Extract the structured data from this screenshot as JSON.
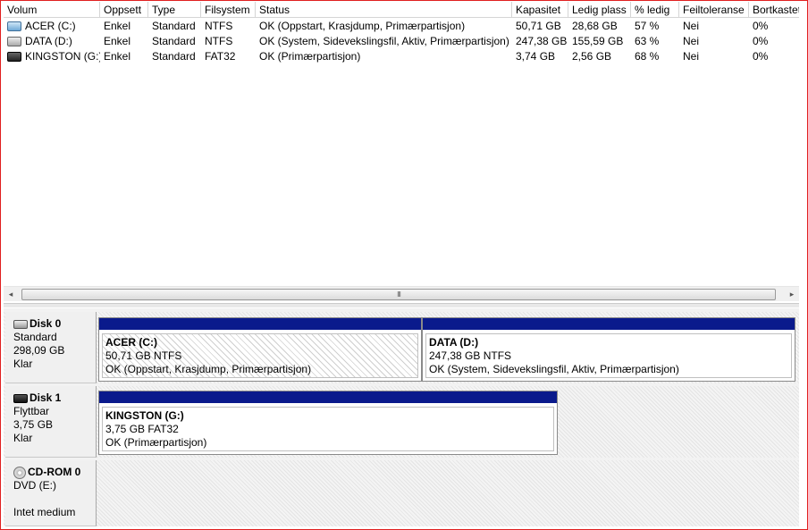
{
  "columns": [
    "Volum",
    "Oppsett",
    "Type",
    "Filsystem",
    "Status",
    "Kapasitet",
    "Ledig plass",
    "% ledig",
    "Feiltoleranse",
    "Bortkastet"
  ],
  "volumes": [
    {
      "icon": "drive-blue-icon",
      "name": "ACER (C:)",
      "layout": "Enkel",
      "type": "Standard",
      "fs": "NTFS",
      "status": "OK (Oppstart, Krasjdump, Primærpartisjon)",
      "capacity": "50,71 GB",
      "free": "28,68 GB",
      "pct": "57 %",
      "fault": "Nei",
      "overhead": "0%"
    },
    {
      "icon": "drive-gray-icon",
      "name": "DATA (D:)",
      "layout": "Enkel",
      "type": "Standard",
      "fs": "NTFS",
      "status": "OK (System, Sidevekslingsfil, Aktiv, Primærpartisjon)",
      "capacity": "247,38 GB",
      "free": "155,59 GB",
      "pct": "63 %",
      "fault": "Nei",
      "overhead": "0%"
    },
    {
      "icon": "usb-drive-icon",
      "name": "KINGSTON (G:)",
      "layout": "Enkel",
      "type": "Standard",
      "fs": "FAT32",
      "status": "OK (Primærpartisjon)",
      "capacity": "3,74 GB",
      "free": "2,56 GB",
      "pct": "68 %",
      "fault": "Nei",
      "overhead": "0%"
    }
  ],
  "scrollbar": {
    "left_arrow": "◂",
    "right_arrow": "▸",
    "grip": "III"
  },
  "disks": [
    {
      "name": "Disk 0",
      "kind": "Standard",
      "size": "298,09 GB",
      "state": "Klar",
      "partitions": [
        {
          "name": "ACER  (C:)",
          "size_fs": "50,71 GB NTFS",
          "status": "OK (Oppstart, Krasjdump, Primærpartisjon)"
        },
        {
          "name": "DATA  (D:)",
          "size_fs": "247,38 GB NTFS",
          "status": "OK (System, Sidevekslingsfil, Aktiv, Primærpartisjon)"
        }
      ]
    },
    {
      "name": "Disk 1",
      "kind": "Flyttbar",
      "size": "3,75 GB",
      "state": "Klar",
      "partitions": [
        {
          "name": "KINGSTON  (G:)",
          "size_fs": "3,75 GB FAT32",
          "status": "OK (Primærpartisjon)"
        }
      ]
    },
    {
      "name": "CD-ROM 0",
      "kind": "DVD (E:)",
      "size": "",
      "state": "Intet medium",
      "partitions": []
    }
  ],
  "colors": {
    "partition_bar": "#0a1a8c",
    "frame_border": "#e02020"
  }
}
